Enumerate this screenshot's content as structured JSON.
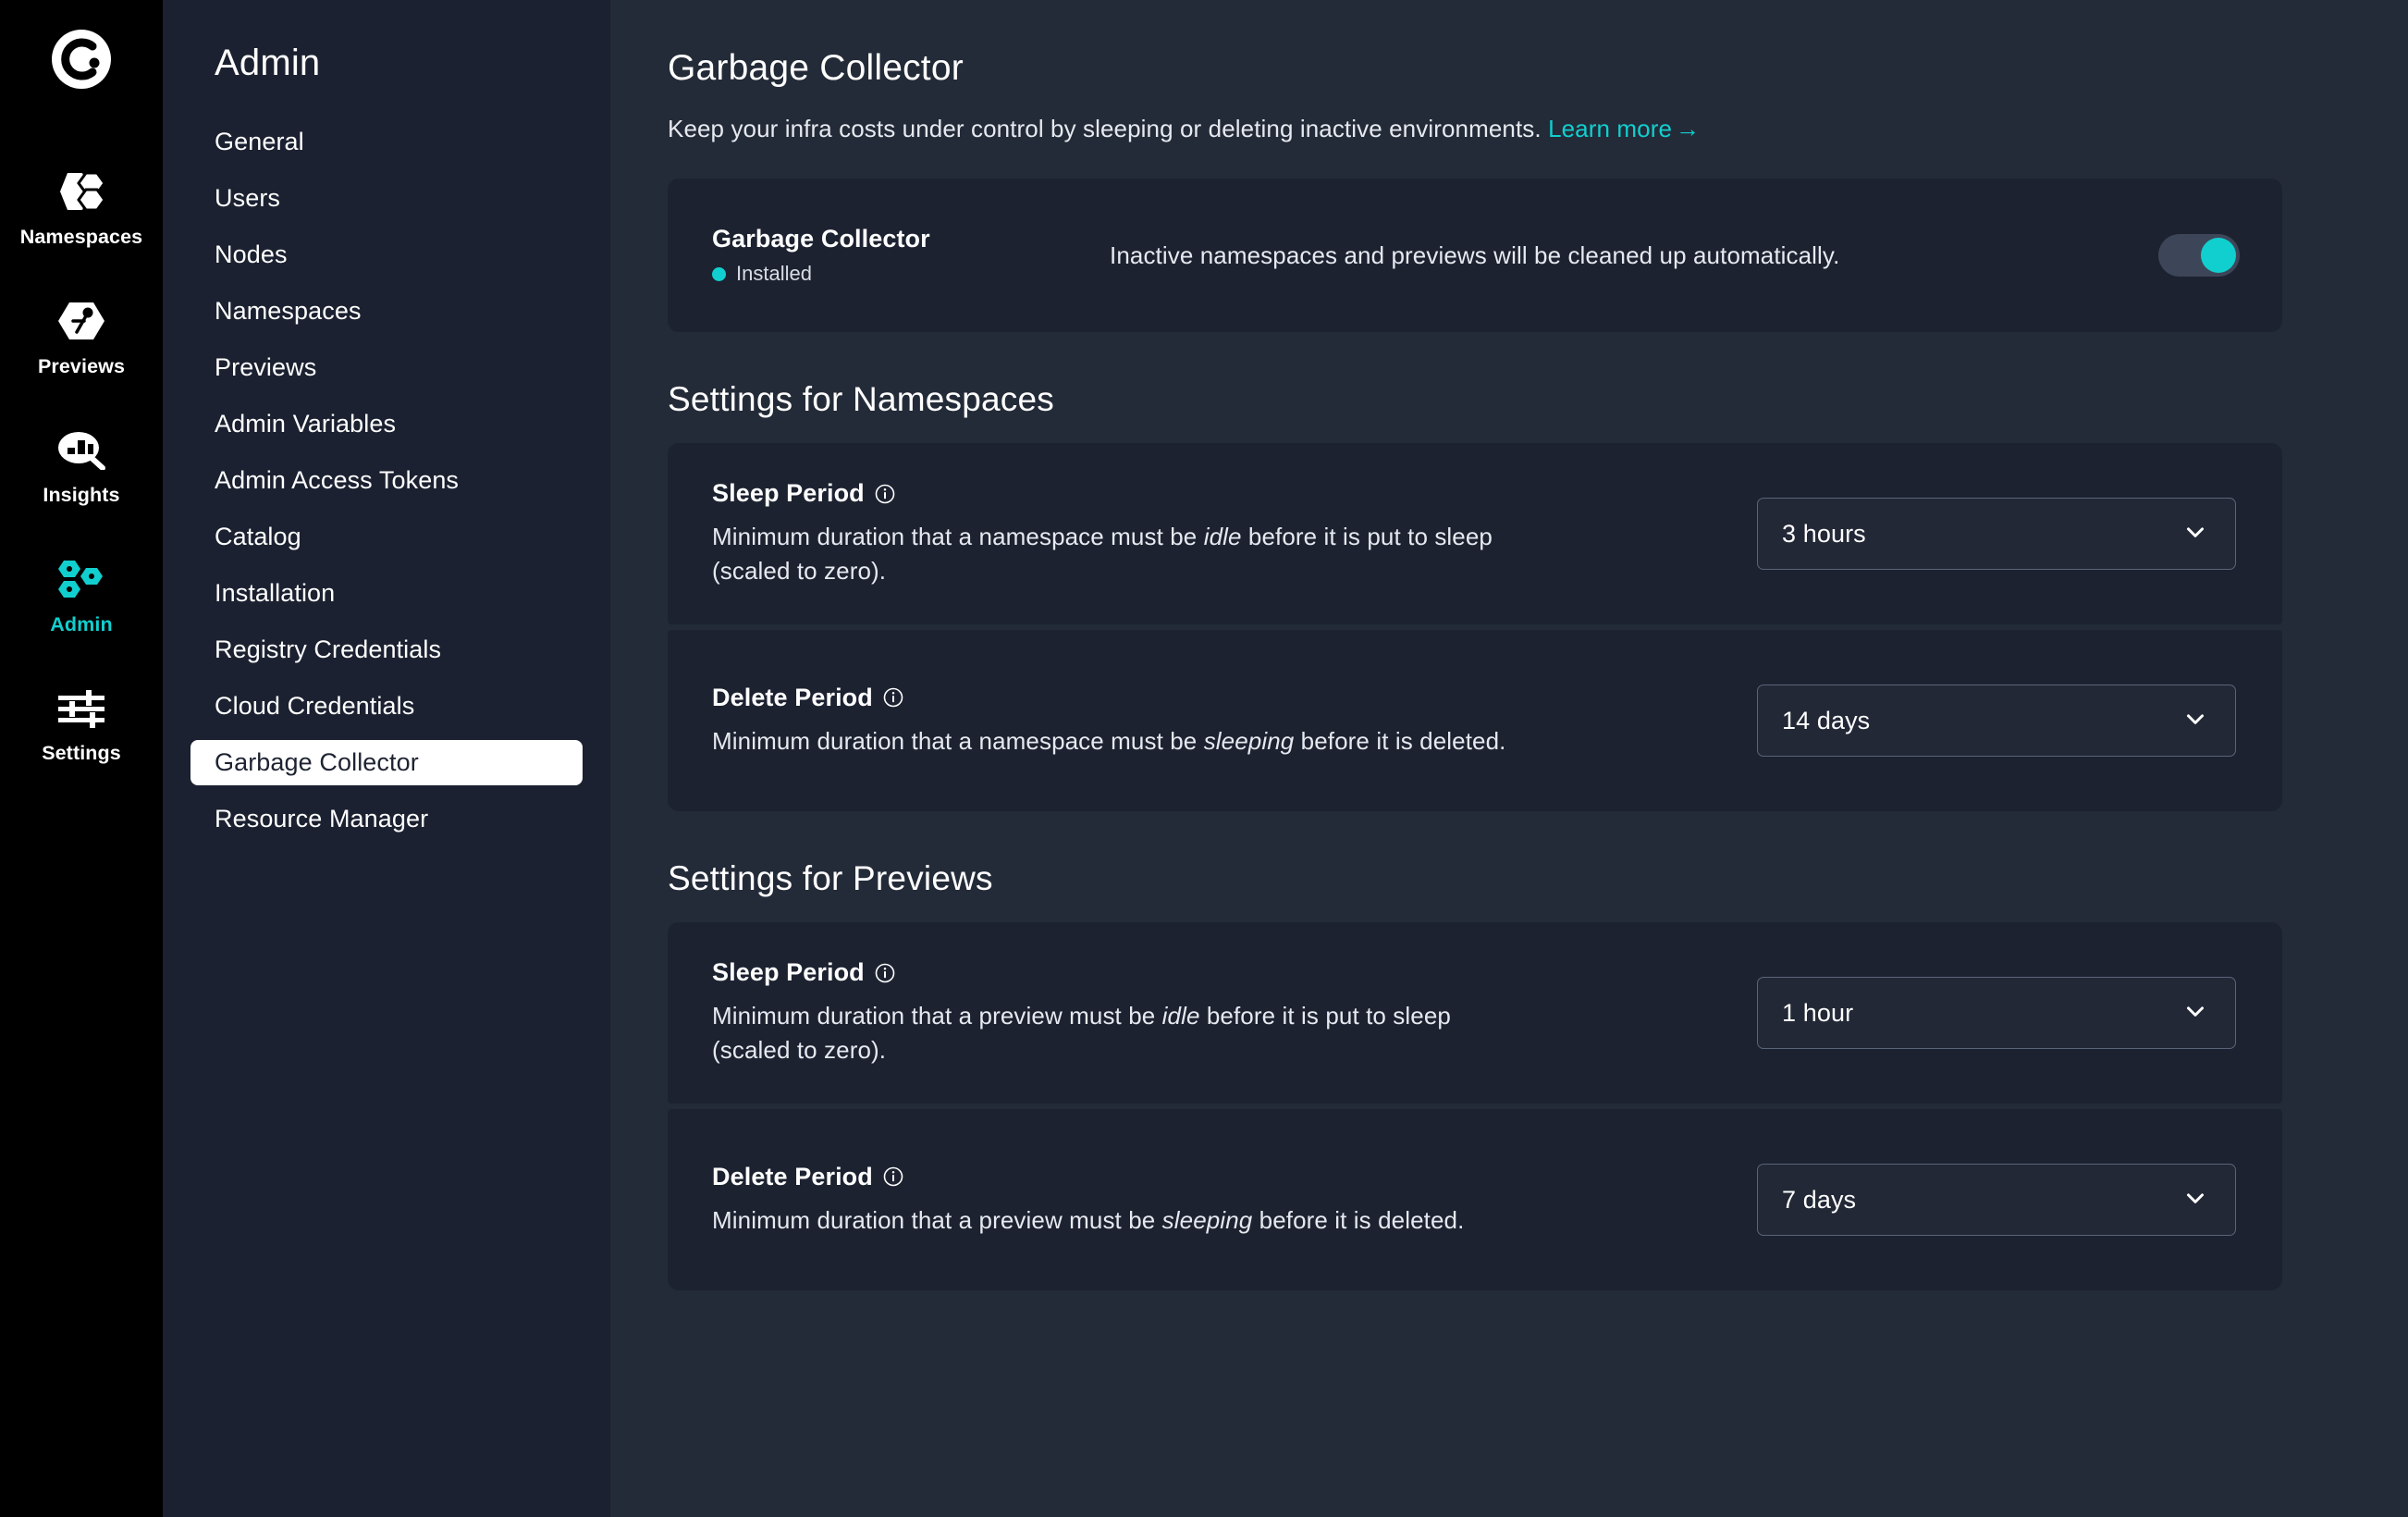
{
  "rail": {
    "logo_icon": "coder-logo-icon",
    "items": [
      {
        "label": "Namespaces",
        "icon": "namespaces-icon",
        "active": false
      },
      {
        "label": "Previews",
        "icon": "previews-icon",
        "active": false
      },
      {
        "label": "Insights",
        "icon": "insights-icon",
        "active": false
      },
      {
        "label": "Admin",
        "icon": "admin-icon",
        "active": true
      },
      {
        "label": "Settings",
        "icon": "settings-icon",
        "active": false
      }
    ]
  },
  "subnav": {
    "title": "Admin",
    "items": [
      {
        "label": "General",
        "active": false
      },
      {
        "label": "Users",
        "active": false
      },
      {
        "label": "Nodes",
        "active": false
      },
      {
        "label": "Namespaces",
        "active": false
      },
      {
        "label": "Previews",
        "active": false
      },
      {
        "label": "Admin Variables",
        "active": false
      },
      {
        "label": "Admin Access Tokens",
        "active": false
      },
      {
        "label": "Catalog",
        "active": false
      },
      {
        "label": "Installation",
        "active": false
      },
      {
        "label": "Registry Credentials",
        "active": false
      },
      {
        "label": "Cloud Credentials",
        "active": false
      },
      {
        "label": "Garbage Collector",
        "active": true
      },
      {
        "label": "Resource Manager",
        "active": false
      }
    ]
  },
  "page": {
    "title": "Garbage Collector",
    "subtitle": "Keep your infra costs under control by sleeping or deleting inactive environments.",
    "learn_more": "Learn more",
    "learn_more_arrow": "→"
  },
  "status_card": {
    "name": "Garbage Collector",
    "state": "Installed",
    "state_color": "#11cfcf",
    "description": "Inactive namespaces and previews will be cleaned up automatically.",
    "toggle_on": true
  },
  "namespaces_section": {
    "title": "Settings for Namespaces",
    "rows": [
      {
        "label": "Sleep Period",
        "info_icon": "info-icon",
        "desc_pre": "Minimum duration that a namespace must be ",
        "desc_em": "idle",
        "desc_post": " before it is put to sleep (scaled to zero).",
        "value": "3 hours"
      },
      {
        "label": "Delete Period",
        "info_icon": "info-icon",
        "desc_pre": "Minimum duration that a namespace must be ",
        "desc_em": "sleeping",
        "desc_post": " before it is deleted.",
        "value": "14 days"
      }
    ]
  },
  "previews_section": {
    "title": "Settings for Previews",
    "rows": [
      {
        "label": "Sleep Period",
        "info_icon": "info-icon",
        "desc_pre": "Minimum duration that a preview must be ",
        "desc_em": "idle",
        "desc_post": " before it is put to sleep (scaled to zero).",
        "value": "1 hour"
      },
      {
        "label": "Delete Period",
        "info_icon": "info-icon",
        "desc_pre": "Minimum duration that a preview must be ",
        "desc_em": "sleeping",
        "desc_post": " before it is deleted.",
        "value": "7 days"
      }
    ]
  },
  "colors": {
    "accent": "#11cfcf",
    "page_bg": "#242b38",
    "card_bg": "#1c2230",
    "subnav_bg": "#1b2130",
    "rail_bg": "#000000"
  }
}
